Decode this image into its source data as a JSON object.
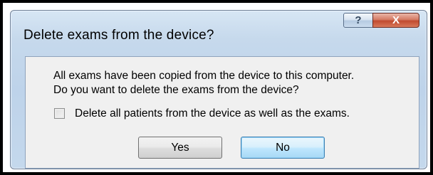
{
  "window": {
    "title": "Delete exams from the device?"
  },
  "titlebar": {
    "help_label": "?",
    "close_label": "X"
  },
  "message": {
    "line1": "All exams have been copied from the device to this computer.",
    "line2": "Do you want to delete the exams from the device?"
  },
  "checkbox": {
    "label": "Delete all patients from the device as well as the exams.",
    "checked": false
  },
  "buttons": {
    "yes_label": "Yes",
    "no_label": "No"
  }
}
